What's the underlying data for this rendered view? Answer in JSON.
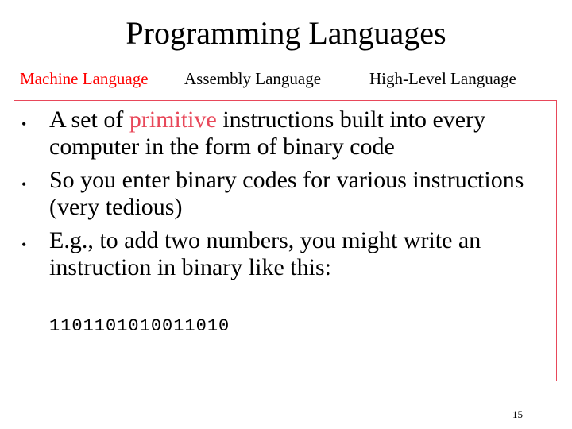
{
  "slide": {
    "title": "Programming Languages",
    "page_number": "15"
  },
  "tabs": [
    {
      "label": "Machine Language",
      "active": true
    },
    {
      "label": "Assembly Language",
      "active": false
    },
    {
      "label": "High-Level Language",
      "active": false
    }
  ],
  "bullets": [
    {
      "segments": [
        "A set of ",
        "primitive",
        " instructions built into every computer in the form of binary code"
      ]
    },
    {
      "text": "So you enter binary codes for various instructions (very tedious)"
    },
    {
      "text": "E.g., to add two numbers, you might write an instruction in binary like this:"
    }
  ],
  "bullet_symbol": "•",
  "binary_example": "1101101010011010",
  "colors": {
    "accent": "#ff0000",
    "highlight": "#e8485a",
    "text": "#000000",
    "background": "#ffffff"
  }
}
